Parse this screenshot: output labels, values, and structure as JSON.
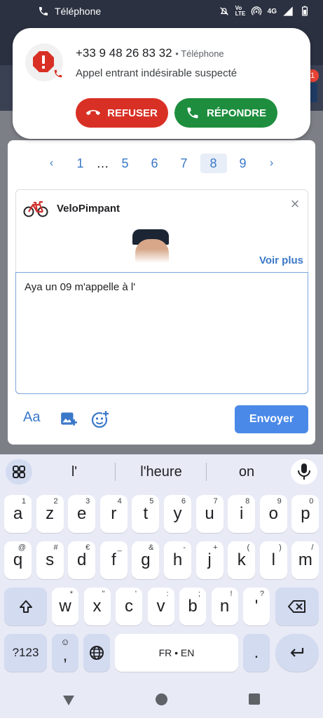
{
  "status_bar": {
    "app_label": "Téléphone",
    "network": "4G",
    "volte": "Vo LTE"
  },
  "notification": {
    "phone_number": "+33 9 48 26 83 32",
    "source": "Téléphone",
    "description": "Appel entrant indésirable suspecté",
    "decline_label": "REFUSER",
    "answer_label": "RÉPONDRE",
    "colors": {
      "decline": "#d93025",
      "answer": "#1e8e3e"
    }
  },
  "background": {
    "badge_count": "1"
  },
  "pagination": {
    "prev": "‹",
    "pages": [
      "1",
      "…",
      "5",
      "6",
      "7",
      "8",
      "9"
    ],
    "current": "8",
    "next": "›"
  },
  "composer": {
    "username": "VeloPimpant",
    "see_more": "Voir plus",
    "text": "Aya un 09 m'appelle à l'",
    "format_label": "Aa",
    "send_label": "Envoyer"
  },
  "keyboard": {
    "suggestions": [
      "l'",
      "l'heure",
      "on"
    ],
    "row1": [
      {
        "k": "a",
        "s": "1"
      },
      {
        "k": "z",
        "s": "2"
      },
      {
        "k": "e",
        "s": "3"
      },
      {
        "k": "r",
        "s": "4"
      },
      {
        "k": "t",
        "s": "5"
      },
      {
        "k": "y",
        "s": "6"
      },
      {
        "k": "u",
        "s": "7"
      },
      {
        "k": "i",
        "s": "8"
      },
      {
        "k": "o",
        "s": "9"
      },
      {
        "k": "p",
        "s": "0"
      }
    ],
    "row2": [
      {
        "k": "q",
        "s": "@"
      },
      {
        "k": "s",
        "s": "#"
      },
      {
        "k": "d",
        "s": "€"
      },
      {
        "k": "f",
        "s": "_"
      },
      {
        "k": "g",
        "s": "&"
      },
      {
        "k": "h",
        "s": "-"
      },
      {
        "k": "j",
        "s": "+"
      },
      {
        "k": "k",
        "s": "("
      },
      {
        "k": "l",
        "s": ")"
      },
      {
        "k": "m",
        "s": "/"
      }
    ],
    "row3": [
      {
        "k": "w",
        "s": "*"
      },
      {
        "k": "x",
        "s": "\""
      },
      {
        "k": "c",
        "s": "'"
      },
      {
        "k": "v",
        "s": ":"
      },
      {
        "k": "b",
        "s": ";"
      },
      {
        "k": "n",
        "s": "!"
      },
      {
        "k": "'",
        "s": "?"
      }
    ],
    "sym_label": "?123",
    "comma": ",",
    "space_label": "FR • EN",
    "period": "."
  }
}
